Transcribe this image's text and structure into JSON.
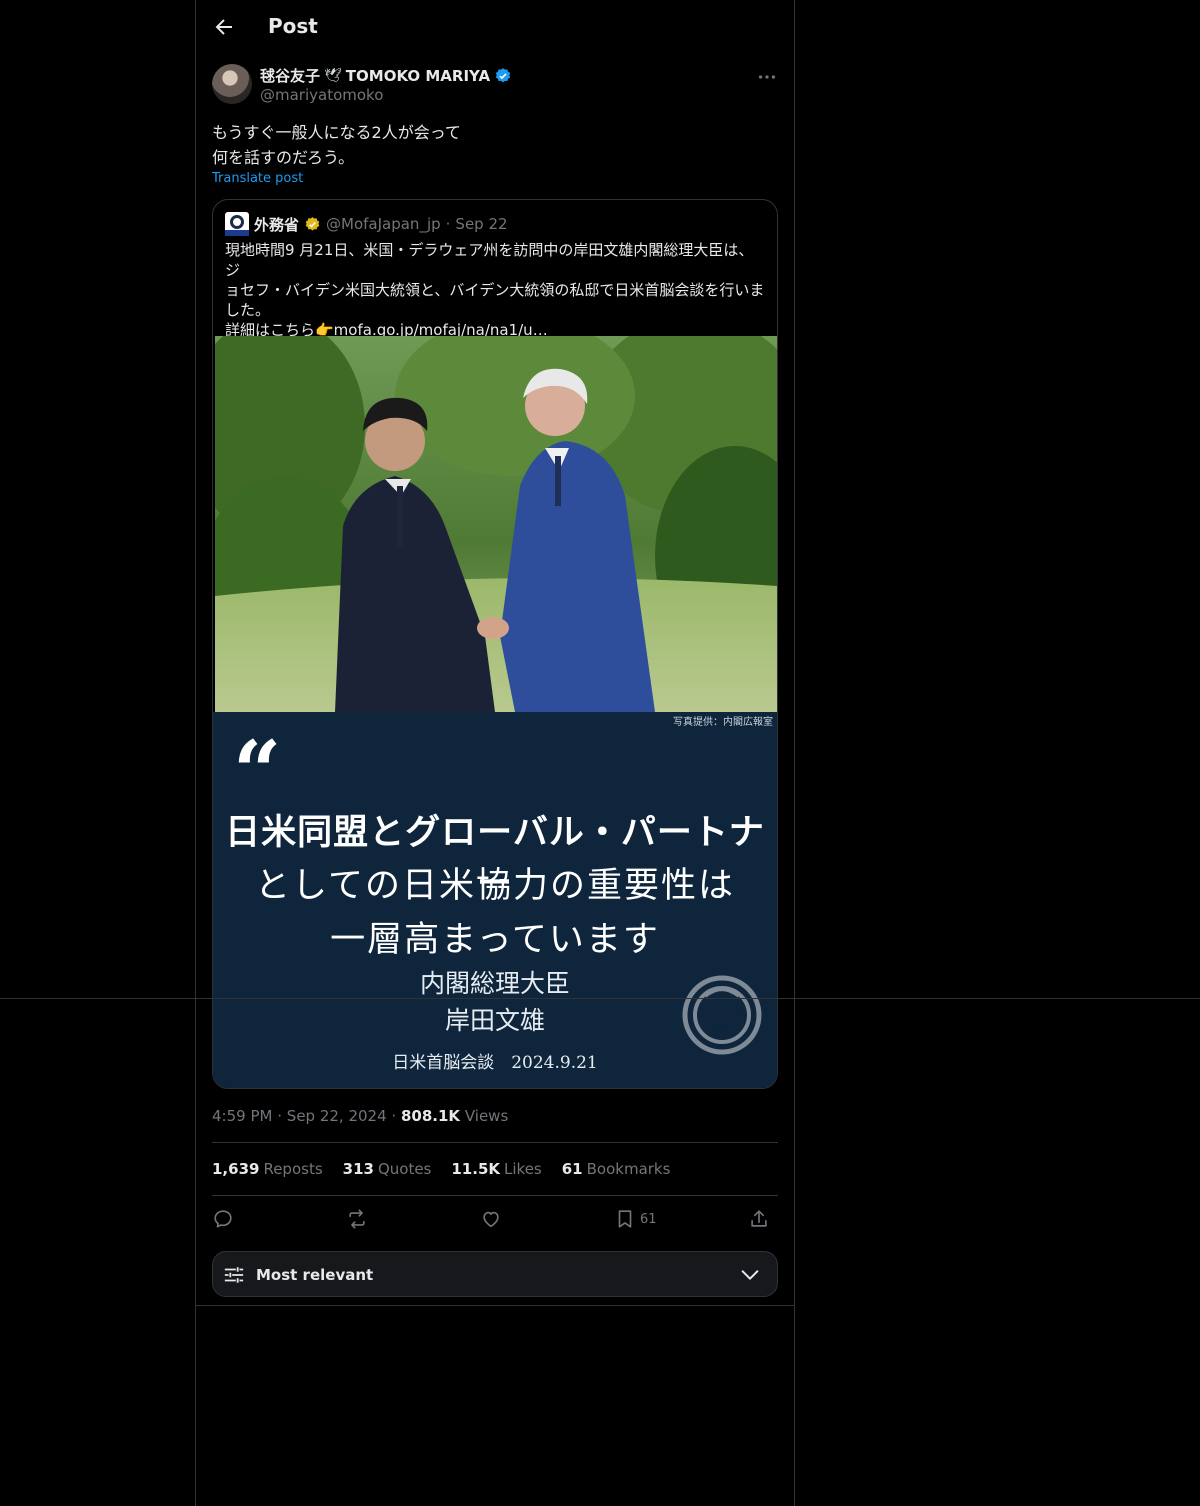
{
  "header": {
    "title": "Post"
  },
  "author": {
    "name": "毬谷友子",
    "dove": "🕊",
    "name_en": "TOMOKO MARIYA",
    "handle": "@mariyatomoko"
  },
  "post": {
    "text_line1": "もうすぐ一般人になる2人が会って",
    "text_line2": "何を話すのだろう。",
    "translate_label": "Translate post"
  },
  "quote": {
    "name": "外務省",
    "handle": "@MofaJapan_jp",
    "dot": "·",
    "date": "Sep 22",
    "text_line1": "現地時間9 月21日、米国・デラウェア州を訪問中の岸田文雄内閣総理大臣は、ジ",
    "text_line2": "ョセフ・バイデン米国大統領と、バイデン大統領の私邸で日米首脳会談を行いま",
    "text_line3": "した。",
    "text_line4": " 詳細はこちら👉mofa.go.jp/mofaj/na/na1/u…",
    "photo_credit": "写真提供：内閣広報室",
    "open_quote": "“",
    "card_line1": "日米同盟とグローバル・パートナー",
    "card_line2": "としての日米協力の重要性は",
    "card_line3": "一層高まっています",
    "card_line4": "内閣総理大臣",
    "card_line5": "岸田文雄",
    "card_line6": "日米首脳会談　2024.9.21"
  },
  "meta": {
    "time": "4:59 PM",
    "dot": "·",
    "date": "Sep 22, 2024",
    "views_count": "808.1K",
    "views_label": "Views"
  },
  "stats": [
    {
      "count": "1,639",
      "label": "Reposts"
    },
    {
      "count": "313",
      "label": "Quotes"
    },
    {
      "count": "11.5K",
      "label": "Likes"
    },
    {
      "count": "61",
      "label": "Bookmarks"
    }
  ],
  "actions": {
    "bookmark_count": "61"
  },
  "sort": {
    "label": "Most relevant"
  },
  "colors": {
    "background": "#000000",
    "border": "#2f3336",
    "accent": "#1d9bf0",
    "muted": "#71767b",
    "card_bg": "#0f253c"
  },
  "icons": [
    "back-arrow-icon",
    "verified-badge-icon",
    "more-icon",
    "reply-icon",
    "repost-icon",
    "like-icon",
    "bookmark-icon",
    "share-icon",
    "filter-icon",
    "chevron-down-icon"
  ]
}
